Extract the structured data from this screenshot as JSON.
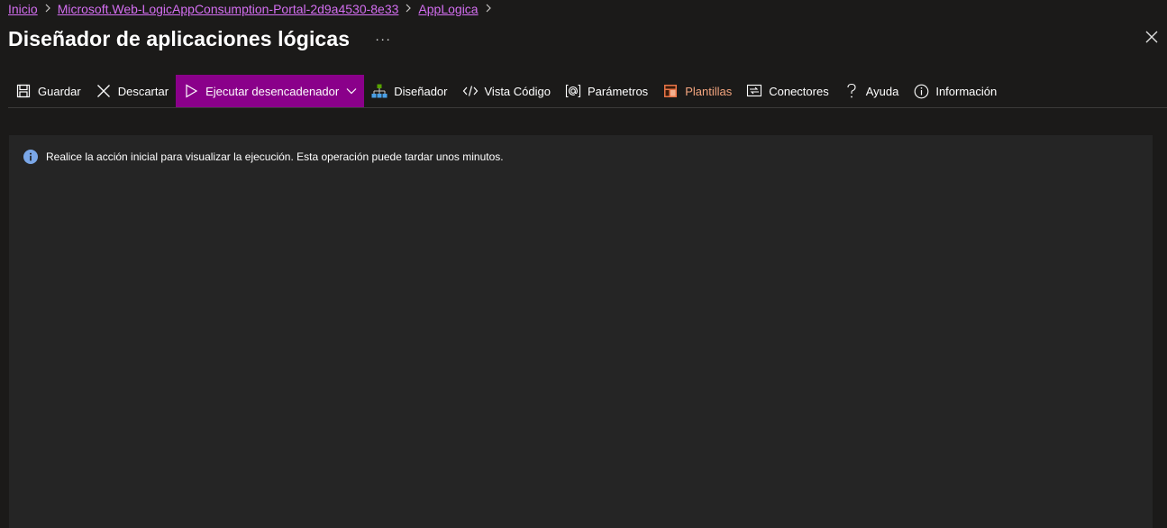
{
  "breadcrumb": {
    "items": [
      {
        "label": "Inicio"
      },
      {
        "label": "Microsoft.Web-LogicAppConsumption-Portal-2d9a4530-8e33"
      },
      {
        "label": "AppLogica"
      }
    ]
  },
  "header": {
    "title": "Diseñador de aplicaciones lógicas",
    "more_label": "···"
  },
  "toolbar": {
    "save": "Guardar",
    "discard": "Descartar",
    "run_trigger": "Ejecutar desencadenador",
    "designer": "Diseñador",
    "code_view": "Vista Código",
    "parameters": "Parámetros",
    "templates": "Plantillas",
    "connectors": "Conectores",
    "help": "Ayuda",
    "info": "Información"
  },
  "canvas": {
    "info_message": "Realice la acción inicial para visualizar la ejecución. Esta operación puede tardar unos minutos."
  },
  "colors": {
    "accent_run": "#8a008a",
    "link": "#d36ef0",
    "templates": "#f3a57f",
    "info_icon": "#7aa7e8"
  },
  "icons": [
    "save-icon",
    "close-icon",
    "play-icon",
    "chevron-down-icon",
    "designer-icon",
    "code-icon",
    "parameters-icon",
    "templates-icon",
    "connectors-icon",
    "help-icon",
    "info-icon"
  ]
}
